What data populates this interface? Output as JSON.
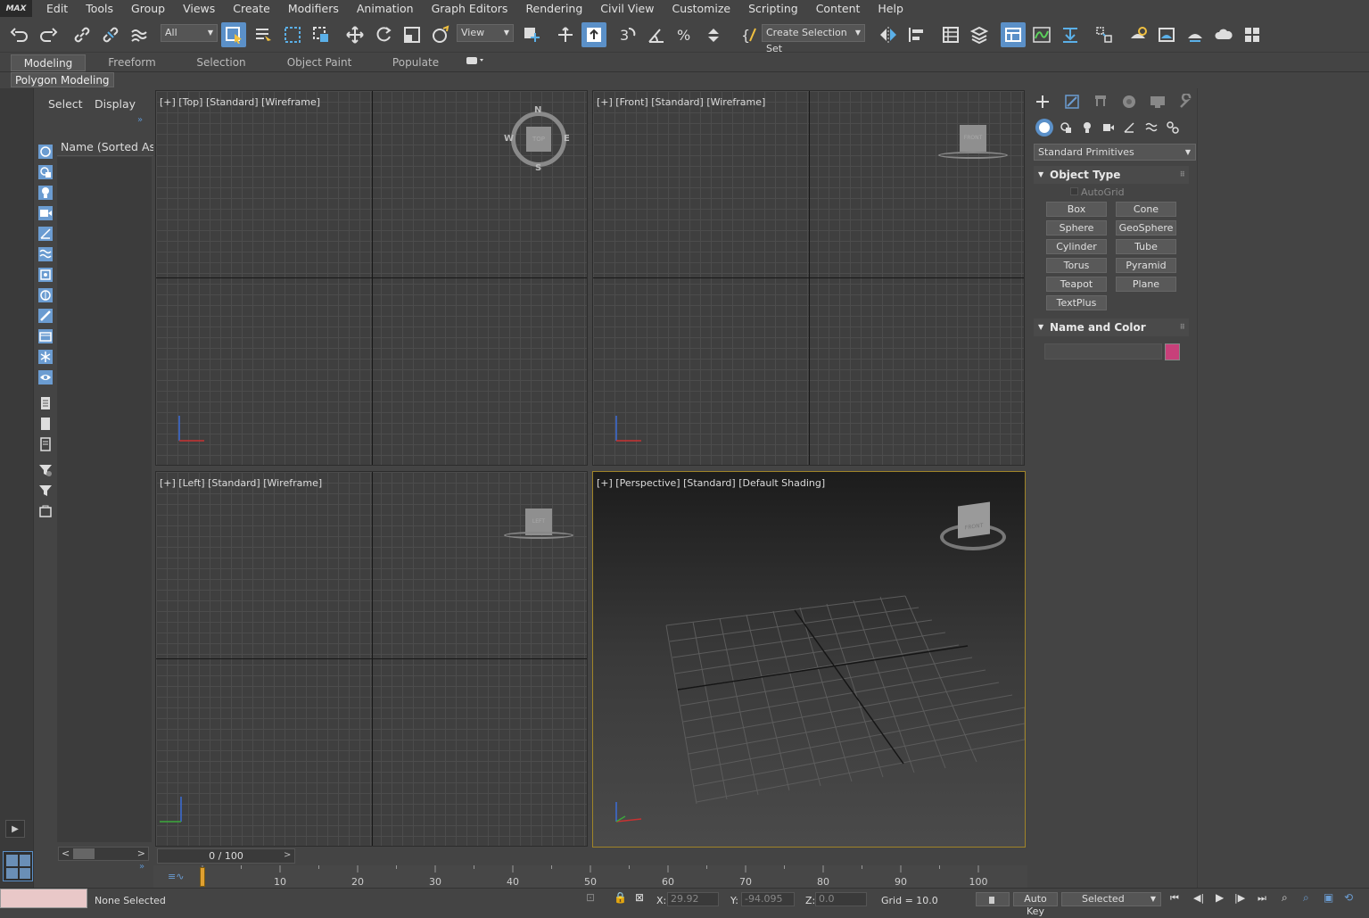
{
  "app": {
    "logo": "MAX"
  },
  "menu": [
    "Edit",
    "Tools",
    "Group",
    "Views",
    "Create",
    "Modifiers",
    "Animation",
    "Graph Editors",
    "Rendering",
    "Civil View",
    "Customize",
    "Scripting",
    "Content",
    "Help"
  ],
  "toolbar": {
    "filter": "All",
    "ref_coord": "View",
    "selection_set": "Create Selection Set"
  },
  "ribbon": {
    "tabs": [
      "Modeling",
      "Freeform",
      "Selection",
      "Object Paint",
      "Populate"
    ],
    "active": "Modeling",
    "panel": "Polygon Modeling"
  },
  "explorer": {
    "select": "Select",
    "display": "Display",
    "name_column": "Name (Sorted Asc"
  },
  "viewports": {
    "top": "[+] [Top] [Standard] [Wireframe]",
    "front": "[+] [Front] [Standard] [Wireframe]",
    "left": "[+] [Left] [Standard] [Wireframe]",
    "perspective": "[+] [Perspective] [Standard] [Default Shading]"
  },
  "viewcube": {
    "top": "TOP",
    "front": "FRONT",
    "left": "LEFT",
    "n": "N",
    "s": "S",
    "e": "E",
    "w": "W"
  },
  "command_panel": {
    "category": "Standard Primitives",
    "object_type": "Object Type",
    "autogrid": "AutoGrid",
    "buttons": [
      "Box",
      "Cone",
      "Sphere",
      "GeoSphere",
      "Cylinder",
      "Tube",
      "Torus",
      "Pyramid",
      "Teapot",
      "Plane",
      "TextPlus"
    ],
    "name_and_color": "Name and Color",
    "color": "#c8407a"
  },
  "timeline": {
    "position": "0 / 100",
    "ticks": [
      "0",
      "10",
      "20",
      "30",
      "40",
      "50",
      "60",
      "70",
      "80",
      "90",
      "100"
    ]
  },
  "status": {
    "selection": "None Selected",
    "x_label": "X:",
    "x_value": "29.92",
    "y_label": "Y:",
    "y_value": "-94.095",
    "z_label": "Z:",
    "z_value": "0.0",
    "grid": "Grid = 10.0",
    "auto_key": "Auto Key",
    "key_mode": "Selected"
  }
}
